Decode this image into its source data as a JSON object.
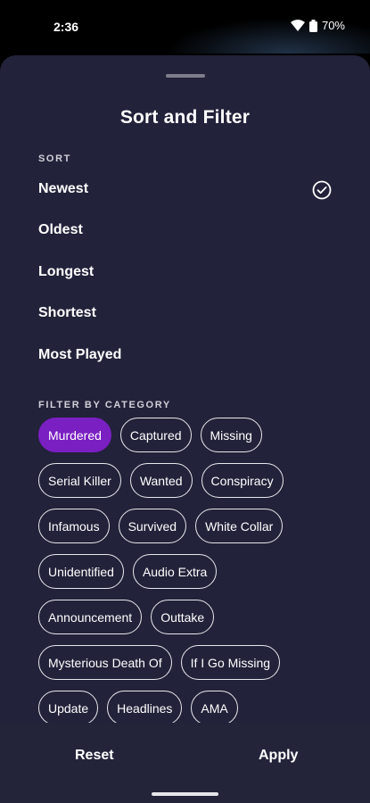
{
  "status_bar": {
    "time": "2:36",
    "battery": "70%"
  },
  "sheet": {
    "title": "Sort and Filter",
    "sort_label": "SORT",
    "sort_options": [
      {
        "label": "Newest",
        "selected": true
      },
      {
        "label": "Oldest",
        "selected": false
      },
      {
        "label": "Longest",
        "selected": false
      },
      {
        "label": "Shortest",
        "selected": false
      },
      {
        "label": "Most Played",
        "selected": false
      }
    ],
    "filter_label": "FILTER BY CATEGORY",
    "categories": [
      [
        "Murdered",
        "Captured",
        "Missing"
      ],
      [
        "Serial Killer",
        "Wanted",
        "Conspiracy"
      ],
      [
        "Infamous",
        "Survived",
        "White Collar"
      ],
      [
        "Unidentified",
        "Audio Extra"
      ],
      [
        "Announcement",
        "Outtake"
      ],
      [
        "Mysterious Death Of",
        "If I Go Missing"
      ],
      [
        "Update",
        "Headlines",
        "AMA"
      ]
    ],
    "selected_category": "Murdered"
  },
  "actions": {
    "reset": "Reset",
    "apply": "Apply"
  },
  "colors": {
    "sheet_bg": "#22223a",
    "accent": "#7a1fc2"
  }
}
